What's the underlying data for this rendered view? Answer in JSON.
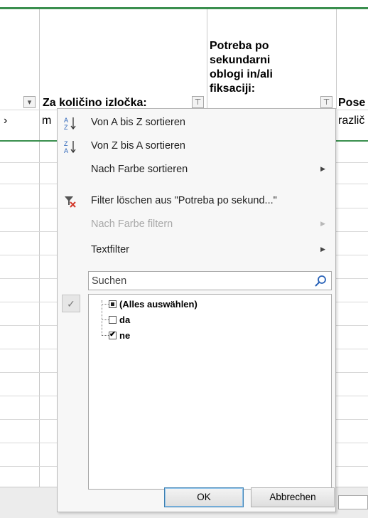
{
  "headers": {
    "col_b": "Za količino izločka:",
    "col_c_lines": [
      "Potreba po",
      "sekundarni",
      "oblogi in/ali",
      "fiksaciji:"
    ],
    "col_d": "Posе"
  },
  "row1": {
    "col_a": "›",
    "col_b": "m",
    "col_d": "različ"
  },
  "menu": {
    "sort_az": "Von A bis Z sortieren",
    "sort_za": "Von Z bis A sortieren",
    "sort_color": "Nach Farbe sortieren",
    "clear_filter": "Filter löschen aus \"Potreba po sekund...\"",
    "filter_color": "Nach Farbe filtern",
    "text_filter": "Textfilter"
  },
  "search": {
    "placeholder": "Suchen"
  },
  "list": [
    {
      "label": "(Alles auswählen)",
      "state": "partial"
    },
    {
      "label": "da",
      "state": "unchecked"
    },
    {
      "label": "ne",
      "state": "checked"
    }
  ],
  "buttons": {
    "ok": "OK",
    "cancel": "Abbrechen"
  },
  "colors": {
    "accent_green": "#3a8f4e",
    "menu_bg": "#f7f7f7",
    "clear_filter_icon": "#d33a2c"
  }
}
